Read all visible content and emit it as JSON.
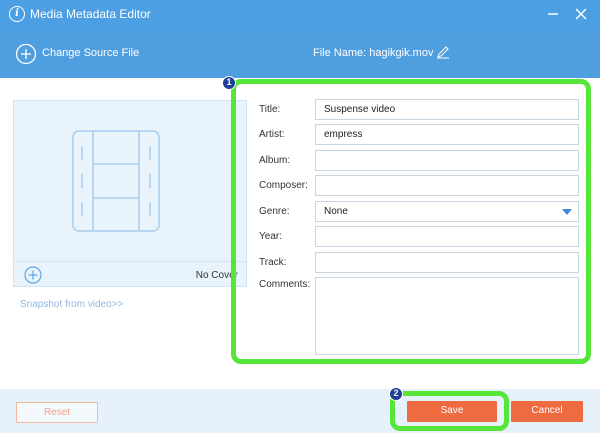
{
  "window": {
    "title": "Media Metadata Editor",
    "info_icon": "i"
  },
  "toolbar": {
    "change_source_label": "Change Source File",
    "file_name_label": "File Name:",
    "file_name_value": "hagikgik.mov"
  },
  "cover": {
    "no_cover_label": "No Cover",
    "snapshot_link": "Snapshot from video>>"
  },
  "form": {
    "title_label": "Title:",
    "title_value": "Suspense video",
    "artist_label": "Artist:",
    "artist_value": "empress",
    "album_label": "Album:",
    "album_value": "",
    "composer_label": "Composer:",
    "composer_value": "",
    "genre_label": "Genre:",
    "genre_value": "None",
    "year_label": "Year:",
    "year_value": "",
    "track_label": "Track:",
    "track_value": "",
    "comments_label": "Comments:",
    "comments_value": ""
  },
  "annotations": {
    "badge_1": "1",
    "badge_2": "2"
  },
  "footer": {
    "reset_label": "Reset",
    "save_label": "Save",
    "cancel_label": "Cancel"
  },
  "colors": {
    "titlebar": "#4c9fe3",
    "toolbar": "#4f9ee0",
    "highlight": "#56e63a",
    "save": "#ee6a40",
    "cancel": "#ee6a40",
    "reset_border": "#f3b79b"
  }
}
